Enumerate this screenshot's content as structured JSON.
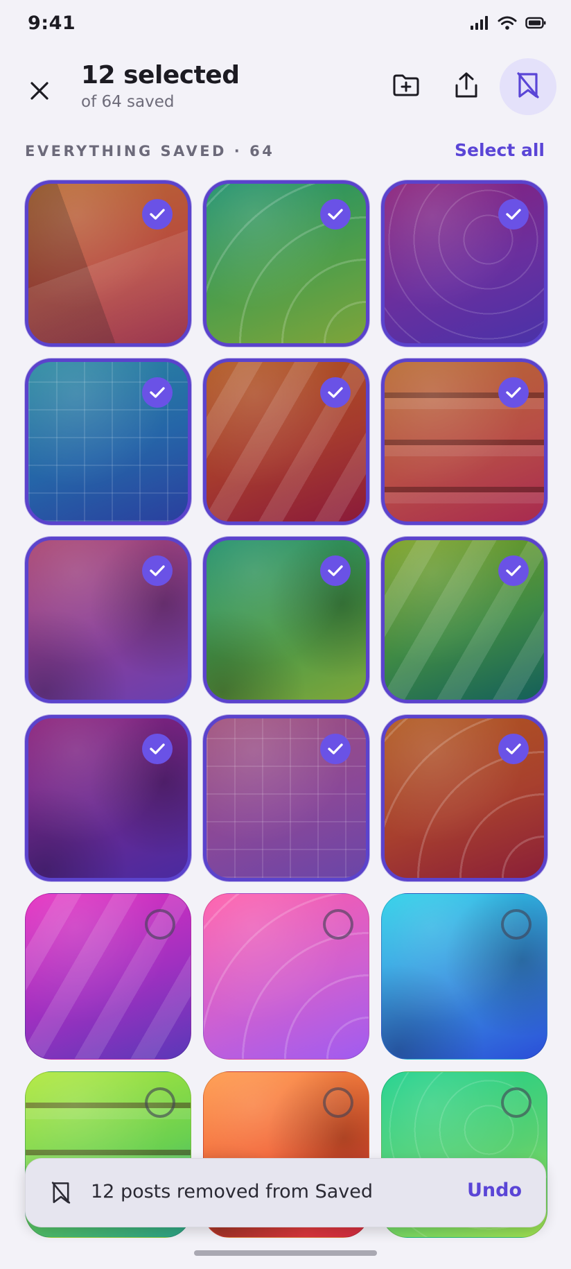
{
  "status_bar": {
    "time": "9:41"
  },
  "header": {
    "title": "12 selected",
    "subtitle": "of 64 saved",
    "close_icon": "close-icon",
    "actions": [
      "folder-add-icon",
      "share-icon",
      "bookmark-remove-icon"
    ]
  },
  "section": {
    "label": "EVERYTHING SAVED · 64",
    "select_all": "Select all"
  },
  "tiles": [
    {
      "selected": true,
      "colors": [
        "#b86a30",
        "#b84a3f",
        "#8f1f3c"
      ],
      "pattern": "shards"
    },
    {
      "selected": true,
      "colors": [
        "#1c8f6a",
        "#4f9e4a",
        "#7ea43a"
      ],
      "pattern": "arcs"
    },
    {
      "selected": true,
      "colors": [
        "#8a1f78",
        "#6a2f9e",
        "#4a32a8"
      ],
      "pattern": "rings"
    },
    {
      "selected": true,
      "colors": [
        "#2a8aa0",
        "#2565a8",
        "#2a3f9e"
      ],
      "pattern": "grid"
    },
    {
      "selected": true,
      "colors": [
        "#b0561e",
        "#a53a2e",
        "#8a1a3a"
      ],
      "pattern": "stripes"
    },
    {
      "selected": true,
      "colors": [
        "#b86a30",
        "#b84e46",
        "#a82a50"
      ],
      "pattern": "bands"
    },
    {
      "selected": true,
      "colors": [
        "#a8426e",
        "#8a3f98",
        "#6a3fb0"
      ],
      "pattern": "blob"
    },
    {
      "selected": true,
      "colors": [
        "#1f8f6a",
        "#4a9a48",
        "#7ea63a"
      ],
      "pattern": "blob"
    },
    {
      "selected": true,
      "colors": [
        "#7aa020",
        "#3f8a45",
        "#145f5a"
      ],
      "pattern": "stripes"
    },
    {
      "selected": true,
      "colors": [
        "#8a1f78",
        "#6a2a92",
        "#4a2aa0"
      ],
      "pattern": "blob"
    },
    {
      "selected": true,
      "colors": [
        "#a0507a",
        "#8a4898",
        "#6a45a8"
      ],
      "pattern": "grid"
    },
    {
      "selected": true,
      "colors": [
        "#b0581e",
        "#a8402e",
        "#8a1f38"
      ],
      "pattern": "arcs"
    },
    {
      "selected": false,
      "colors": [
        "#e62ec0",
        "#a030c0",
        "#5a38b8"
      ],
      "pattern": "stripes"
    },
    {
      "selected": false,
      "colors": [
        "#ff5aa8",
        "#d060d0",
        "#a05cf0"
      ],
      "pattern": "arcs"
    },
    {
      "selected": false,
      "colors": [
        "#2ad0e8",
        "#3a8ee0",
        "#2a4ed8"
      ],
      "pattern": "blob"
    },
    {
      "selected": false,
      "colors": [
        "#b0e83a",
        "#6ad050",
        "#2aa088"
      ],
      "pattern": "bands"
    },
    {
      "selected": false,
      "colors": [
        "#ff9a4a",
        "#f05a30",
        "#d02a40"
      ],
      "pattern": "blob"
    },
    {
      "selected": false,
      "colors": [
        "#1ad08a",
        "#5ad070",
        "#a0e050"
      ],
      "pattern": "rings"
    }
  ],
  "snackbar": {
    "message": "12 posts removed from Saved",
    "action": "Undo"
  }
}
